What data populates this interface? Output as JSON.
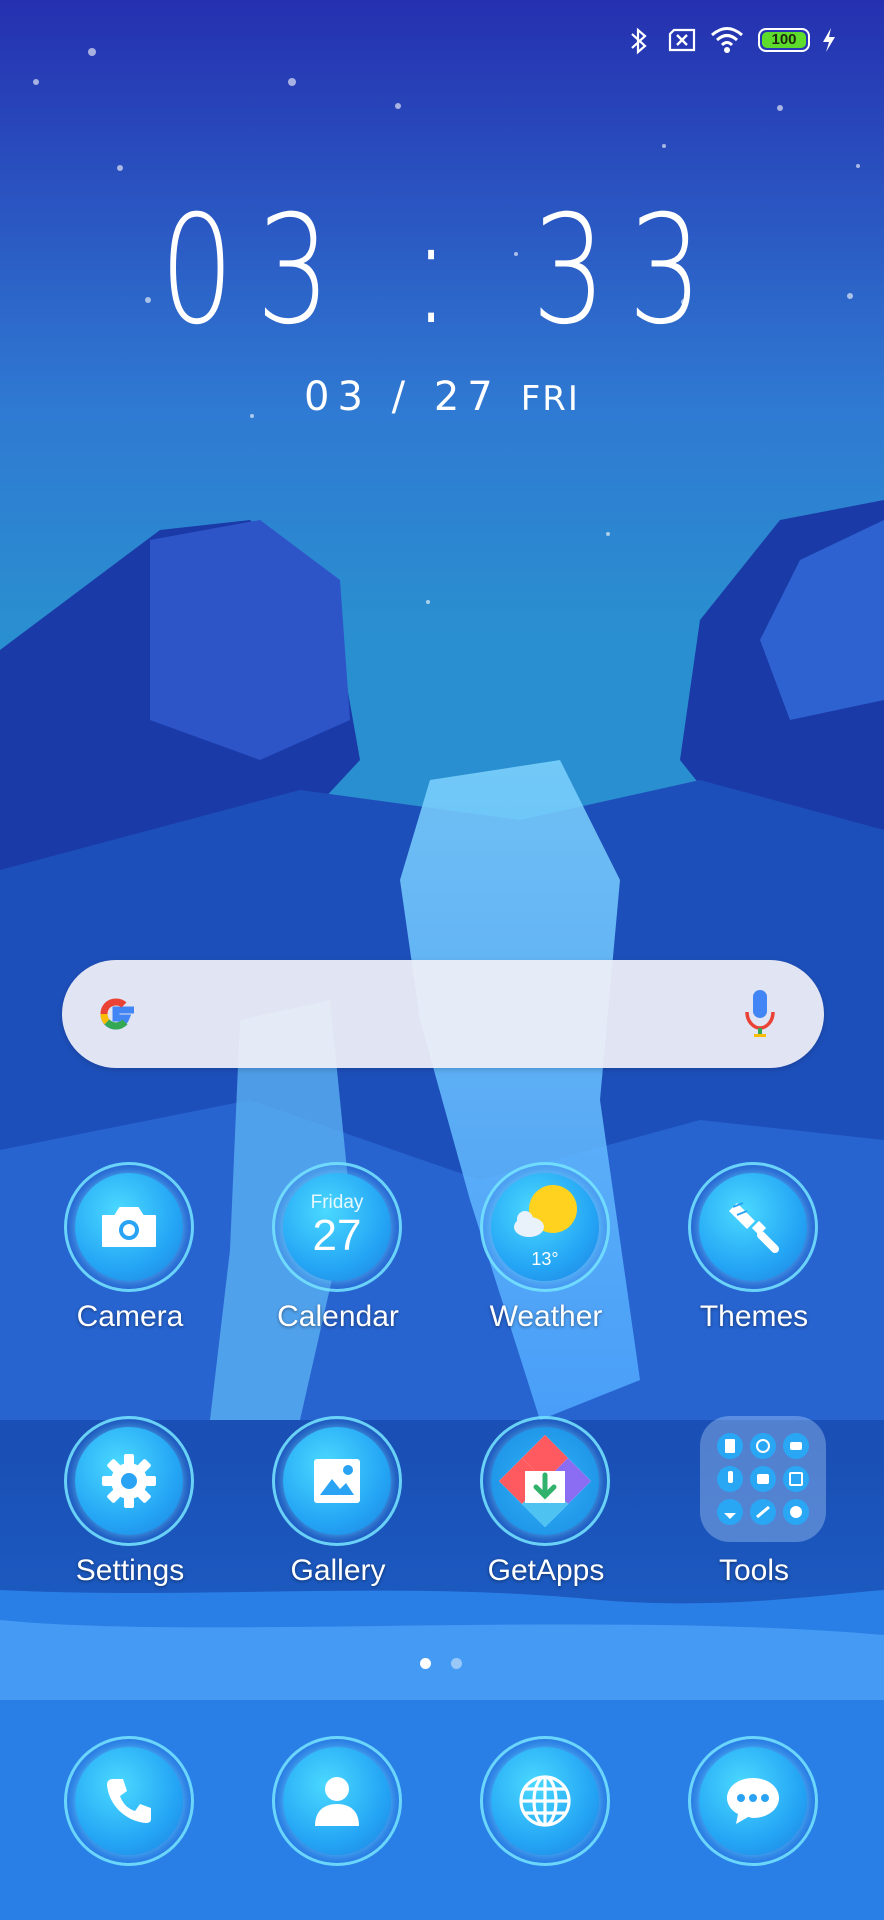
{
  "status_bar": {
    "icons": [
      "bluetooth-icon",
      "no-sim-icon",
      "wifi-icon",
      "battery-icon",
      "charging-icon"
    ],
    "battery_level": "100",
    "battery_color": "#5ddc2b"
  },
  "clock": {
    "time": "03 : 33",
    "date": "03 / 27",
    "weekday": "FRI"
  },
  "search": {
    "logo": "google-g-icon",
    "voice": "microphone-icon"
  },
  "apps": [
    {
      "label": "Camera",
      "icon": "camera-icon"
    },
    {
      "label": "Calendar",
      "icon": "calendar-icon",
      "day_name": "Friday",
      "day_number": "27"
    },
    {
      "label": "Weather",
      "icon": "weather-icon",
      "temperature": "13°"
    },
    {
      "label": "Themes",
      "icon": "paintbrush-icon"
    },
    {
      "label": "Settings",
      "icon": "gear-icon"
    },
    {
      "label": "Gallery",
      "icon": "image-icon"
    },
    {
      "label": "GetApps",
      "icon": "getapps-icon"
    },
    {
      "label": "Tools",
      "icon": "folder-icon"
    }
  ],
  "pager": {
    "pages": 2,
    "current": 1
  },
  "dock": [
    {
      "icon": "phone-icon"
    },
    {
      "icon": "contacts-icon"
    },
    {
      "icon": "browser-globe-icon"
    },
    {
      "icon": "messages-icon"
    }
  ]
}
